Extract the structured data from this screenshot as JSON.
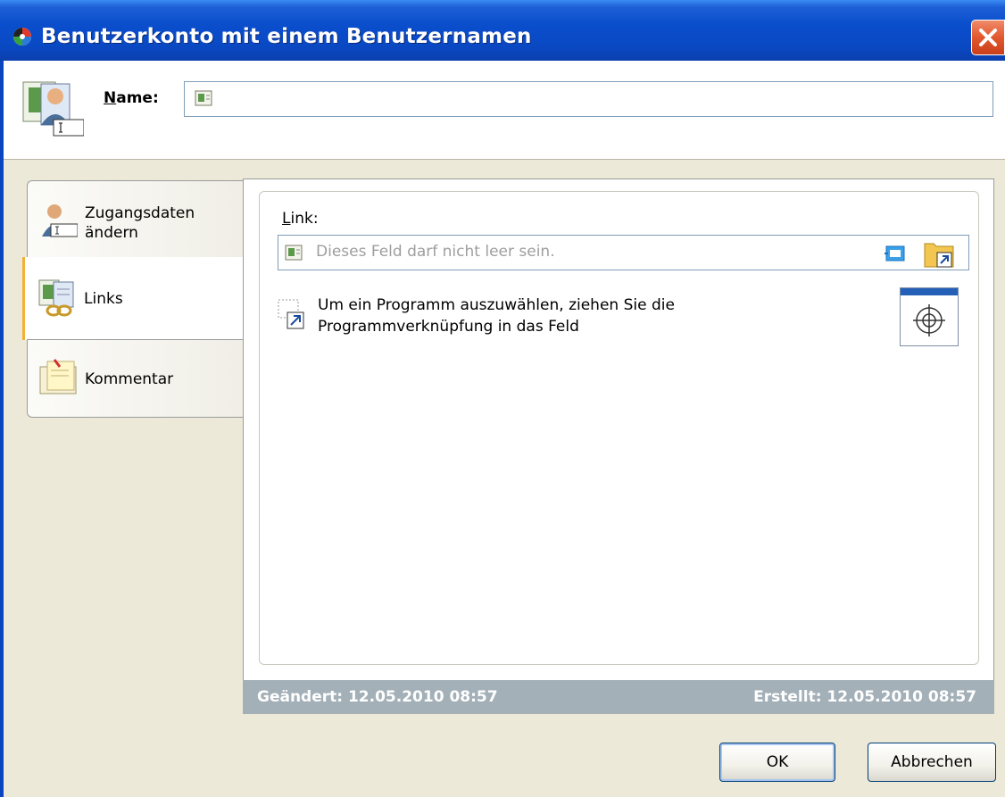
{
  "window": {
    "title": "Benutzerkonto mit einem Benutzernamen",
    "close_icon": "close-icon"
  },
  "header": {
    "icon": "user-account-icon",
    "name_label_prefix": "N",
    "name_label_rest": "ame:",
    "name_value": ""
  },
  "tabs": [
    {
      "label_line1": "Zugangsdaten",
      "label_line2": "ändern",
      "icon": "user-credentials-icon",
      "active": false
    },
    {
      "label": "Links",
      "icon": "links-icon",
      "active": true
    },
    {
      "label": "Kommentar",
      "icon": "comment-icon",
      "active": false
    }
  ],
  "links_panel": {
    "link_label_prefix": "L",
    "link_label_rest": "ink:",
    "link_placeholder": "Dieses Feld darf nicht leer sein.",
    "hint_line1": "Um ein Programm auszuwählen, ziehen Sie die",
    "hint_line2": "Programmverknüpfung in das Feld"
  },
  "status": {
    "changed": "Geändert: 12.05.2010 08:57",
    "created": "Erstellt: 12.05.2010 08:57"
  },
  "buttons": {
    "ok": "OK",
    "cancel": "Abbrechen"
  },
  "colors": {
    "titlebar": "#0a4ecc",
    "close": "#e2582e",
    "active_tab_marker": "#f2b134",
    "status_bar": "#a3b0b8"
  }
}
